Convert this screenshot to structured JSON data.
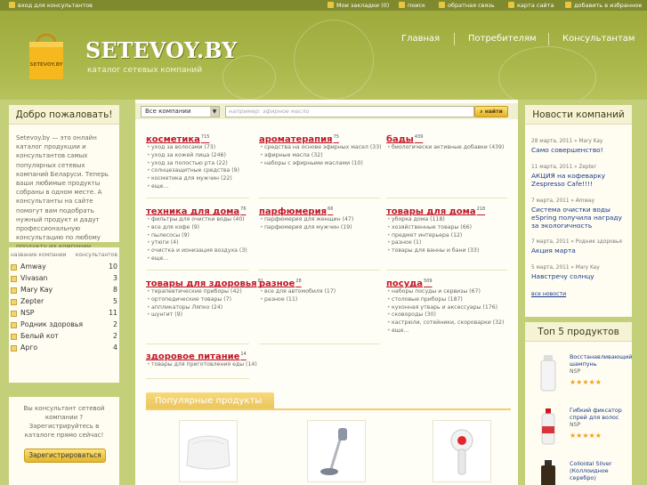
{
  "topbar": {
    "consultant_login": "вход для консультантов",
    "bookmarks": "Мои закладки (0)",
    "search": "поиск",
    "feedback": "обратная связь",
    "sitemap": "карта сайта",
    "favorite": "добавить в избранное"
  },
  "header": {
    "logo": "SETEVOY.BY",
    "tagline": "каталог сетевых компаний",
    "bag_text": "SETEVOY.BY",
    "nav": [
      "Главная",
      "Потребителям",
      "Консультантам"
    ]
  },
  "welcome": {
    "title": "Добро пожаловать!",
    "text": "Setevoy.by — это онлайн каталог продукции и консультантов самых популярных сетевых компаний Беларуси. Теперь ваши любимые продукты собраны в одном месте. А консультанты на сайте помогут вам подобрать нужный продукт и дадут профессиональную консультацию по любому продукту их компании."
  },
  "companies": {
    "col_name": "название компании",
    "col_count": "консультантов",
    "items": [
      {
        "name": "Amway",
        "count": "10"
      },
      {
        "name": "Vivasan",
        "count": "3"
      },
      {
        "name": "Mary Kay",
        "count": "8"
      },
      {
        "name": "Zepter",
        "count": "5"
      },
      {
        "name": "NSP",
        "count": "11"
      },
      {
        "name": "Родник здоровья",
        "count": "2"
      },
      {
        "name": "Белый кот",
        "count": "2"
      },
      {
        "name": "Арго",
        "count": "4"
      }
    ]
  },
  "register": {
    "text": "Вы консультант сетевой компании ? Зарегистрируйтесь в каталоге прямо сейчас!",
    "button": "Зарегистрироваться"
  },
  "search": {
    "select_value": "Все компании",
    "placeholder": "например: эфирное масло",
    "button": "найти"
  },
  "categories": [
    {
      "title": "косметика",
      "count": "715",
      "items": [
        "уход за волосами (73)",
        "уход за кожей лица (246)",
        "уход за полостью рта (22)",
        "солнцезащитные средства (9)",
        "косметика для мужчин (22)",
        "еще..."
      ]
    },
    {
      "title": "ароматерапия",
      "count": "75",
      "items": [
        "средства на основе эфирных масел (33)",
        "эфирные масла (32)",
        "наборы с эфирными маслами (10)"
      ]
    },
    {
      "title": "бады",
      "count": "439",
      "items": [
        "биологически активные добавки (439)"
      ]
    },
    {
      "title": "техника для дома",
      "count": "76",
      "items": [
        "фильтры для очистки воды (40)",
        "все для кофе (9)",
        "пылесосы (9)",
        "утюги (4)",
        "очистка и ионизация воздуха (3)",
        "еще..."
      ]
    },
    {
      "title": "парфюмерия",
      "count": "66",
      "items": [
        "парфюмерия для женщин (47)",
        "парфюмерия для мужчин (19)"
      ]
    },
    {
      "title": "товары для дома",
      "count": "218",
      "items": [
        "уборка дома (118)",
        "хозяйственные товары (66)",
        "предмет интерьера (12)",
        "разное (1)",
        "товары для ванны и бани (33)"
      ]
    },
    {
      "title": "товары для здоровья",
      "count": "81",
      "items": [
        "терапевтические приборы (42)",
        "ортопедические товары (7)",
        "аппликаторы Ляпко (24)",
        "шунгит (9)"
      ]
    },
    {
      "title": "разное",
      "count": "28",
      "items": [
        "все для автомобиля (17)",
        "разное (11)"
      ]
    },
    {
      "title": "посуда",
      "count": "509",
      "items": [
        "наборы посуды и сервизы (67)",
        "столовые приборы (187)",
        "кухонная утварь и аксессуары (176)",
        "сковороды (30)",
        "кастрюли, сотейники, скороварки (32)",
        "еще..."
      ]
    },
    {
      "title": "здоровое питание",
      "count": "14",
      "items": [
        "товары для приготовления еды (14)"
      ]
    }
  ],
  "popular": {
    "title": "Популярные продукты",
    "items": [
      "pillow",
      "vacuum-cleaner",
      "massager"
    ]
  },
  "news": {
    "title": "Новости компаний",
    "items": [
      {
        "date": "28 марта, 2011 » Mary Kay",
        "title": "Само совершенство!"
      },
      {
        "date": "11 марта, 2011 » Zepter",
        "title": "АКЦИЯ на кофеварку Zespresso Cafe!!!!"
      },
      {
        "date": "7 марта, 2011 » Amway",
        "title": "Система очистки воды eSpring получила награду за экологичность"
      },
      {
        "date": "7 марта, 2011 » Родник здоровья",
        "title": "Акция марта"
      },
      {
        "date": "5 марта, 2011 » Mary Kay",
        "title": "Навстречу солнцу"
      }
    ],
    "all": "все новости"
  },
  "top5": {
    "title": "Топ 5 продуктов",
    "items": [
      {
        "name": "Восстанавливающий шампунь",
        "brand": "NSP",
        "rating": 5
      },
      {
        "name": "Гибкий фиксатор спрей для волос",
        "brand": "NSP",
        "rating": 5
      },
      {
        "name": "Colloidal Silver (Коллоидное серебро)",
        "brand": "",
        "rating": 5
      }
    ]
  },
  "colors": {
    "accent_red": "#c0182a",
    "link_blue": "#1a3a8a",
    "olive": "#9eaa3c",
    "gold": "#f0a11c"
  }
}
